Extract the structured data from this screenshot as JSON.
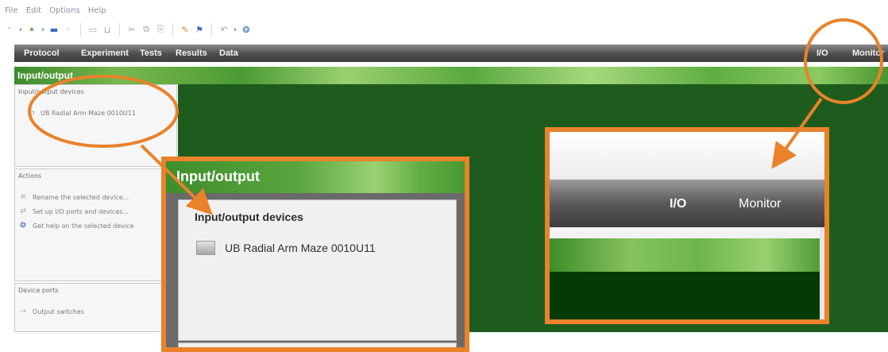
{
  "menu": [
    "File",
    "Edit",
    "Options",
    "Help"
  ],
  "toolbar": {
    "icons": [
      {
        "name": "new-icon",
        "glyph": "⁺",
        "cls": "c-gray"
      },
      {
        "name": "dropdown-icon",
        "glyph": "▾",
        "cls": "c-gray small"
      },
      {
        "name": "open-icon",
        "glyph": "✦",
        "cls": "c-green"
      },
      {
        "name": "dropdown-icon",
        "glyph": "▾",
        "cls": "c-gray small"
      },
      {
        "name": "save-icon",
        "glyph": "▬",
        "cls": "c-blue"
      },
      {
        "name": "settings-icon",
        "glyph": "◦",
        "cls": "c-gray"
      },
      {
        "name": "separator",
        "glyph": "",
        "cls": "sep"
      },
      {
        "name": "page-icon",
        "glyph": "▭",
        "cls": "c-gray"
      },
      {
        "name": "page-icon",
        "glyph": "⊔",
        "cls": "c-gray"
      },
      {
        "name": "separator",
        "glyph": "",
        "cls": "sep"
      },
      {
        "name": "cut-icon",
        "glyph": "✂",
        "cls": "c-gray"
      },
      {
        "name": "copy-icon",
        "glyph": "⧉",
        "cls": "c-gray"
      },
      {
        "name": "paste-icon",
        "glyph": "⎘",
        "cls": "c-gray"
      },
      {
        "name": "separator",
        "glyph": "",
        "cls": "sep"
      },
      {
        "name": "edit-icon",
        "glyph": "✎",
        "cls": "c-orange"
      },
      {
        "name": "flag-icon",
        "glyph": "⚑",
        "cls": "c-blue"
      },
      {
        "name": "separator",
        "glyph": "",
        "cls": "sep"
      },
      {
        "name": "undo-icon",
        "glyph": "↶",
        "cls": "c-gray"
      },
      {
        "name": "dropdown-icon",
        "glyph": "▾",
        "cls": "c-gray small"
      },
      {
        "name": "help-icon",
        "glyph": "❂",
        "cls": "c-blue"
      }
    ]
  },
  "nav": {
    "protocol": "Protocol",
    "experiment": "Experiment",
    "tests": "Tests",
    "results": "Results",
    "data": "Data",
    "io": "I/O",
    "monitor": "Monitor"
  },
  "title": "Input/output",
  "devices_panel": {
    "title": "Input/output devices",
    "device": "UB Radial Arm Maze 0010U11"
  },
  "actions_panel": {
    "title": "Actions",
    "rename": "Rename the selected device...",
    "setup": "Set up I/O ports and devices...",
    "help": "Get help on the selected device"
  },
  "ports_panel": {
    "title": "Device ports",
    "output_switches": "Output switches"
  },
  "zoom_left": {
    "title": "Input/output",
    "panel_title": "Input/output devices",
    "device": "UB Radial Arm Maze 0010U11"
  },
  "zoom_right": {
    "io": "I/O",
    "monitor": "Monitor"
  },
  "colors": {
    "annotation": "#e9822a",
    "work_area": "#1e5c1e",
    "nav_bar": "#4d4d4d"
  }
}
